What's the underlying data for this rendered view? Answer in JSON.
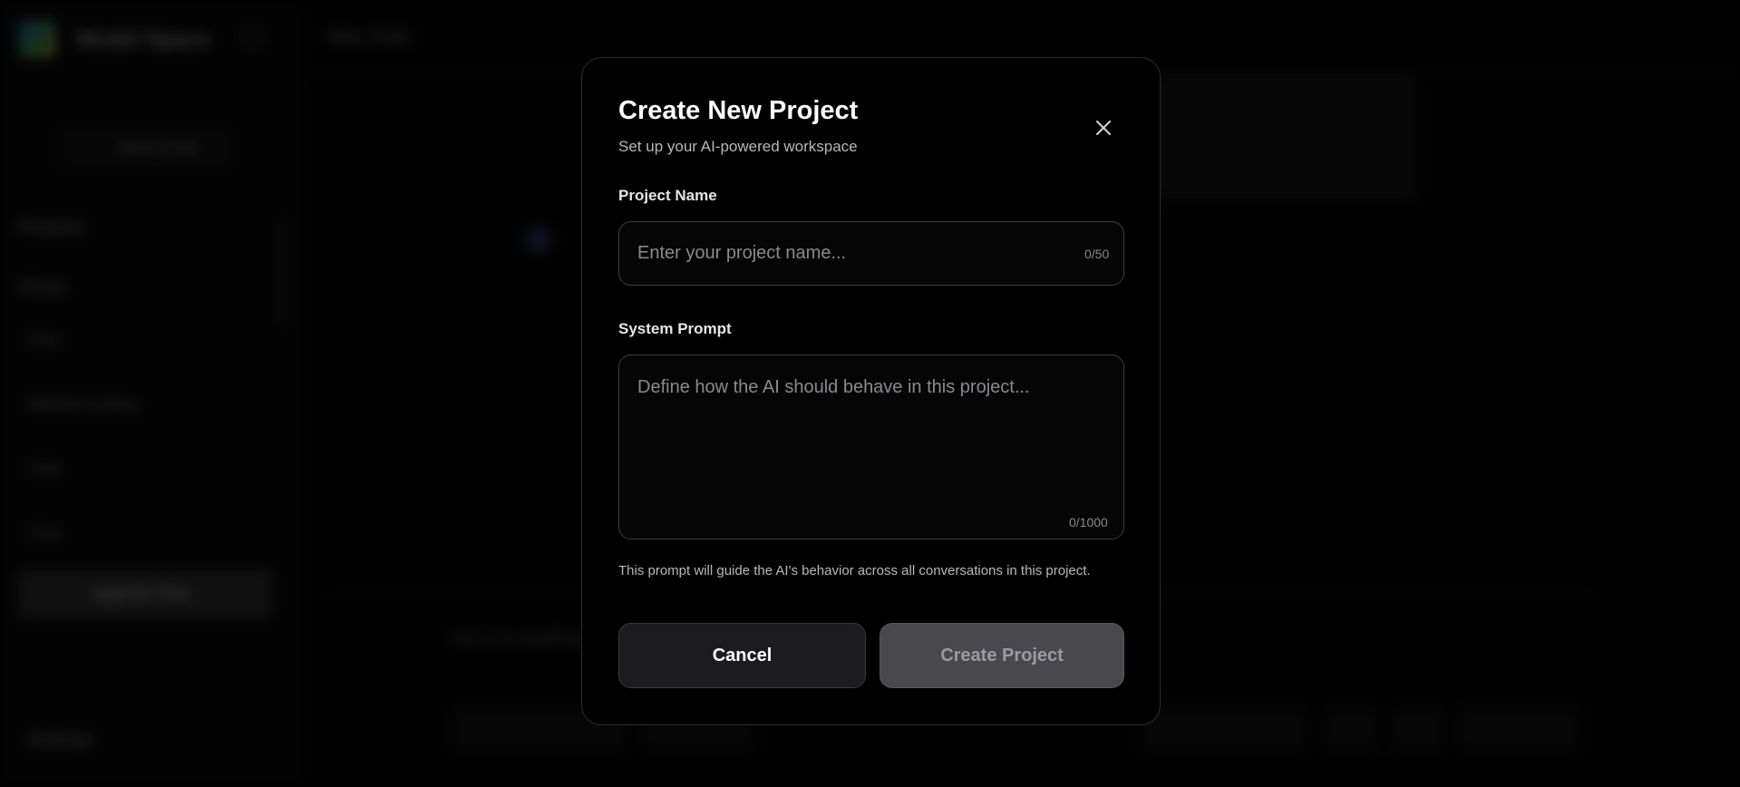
{
  "background": {
    "brand": "Model Space",
    "topbar_item": "New Chat",
    "new_chat_label": "New Chat",
    "projects_label": "Projects",
    "chats_label": "Chats",
    "chat_items": [
      "Chat",
      "Website landing",
      "Chat",
      "Chat"
    ],
    "upgrade_label": "Upgrade Plan",
    "settings_label": "Settings",
    "input_placeholder": "Ask me anything..."
  },
  "modal": {
    "title": "Create New Project",
    "subtitle": "Set up your AI-powered workspace",
    "close_icon": "close-icon",
    "project_name": {
      "label": "Project Name",
      "placeholder": "Enter your project name...",
      "value": "",
      "counter": "0/50"
    },
    "system_prompt": {
      "label": "System Prompt",
      "placeholder": "Define how the AI should behave in this project...",
      "value": "",
      "counter": "0/1000"
    },
    "helper_text": "This prompt will guide the AI's behavior across all conversations in this project.",
    "cancel_label": "Cancel",
    "create_label": "Create Project"
  },
  "colors": {
    "modal_bg": "#000000",
    "modal_border": "#2c2c2e",
    "create_disabled_bg": "#48484d",
    "cancel_bg": "#1c1c1f"
  }
}
